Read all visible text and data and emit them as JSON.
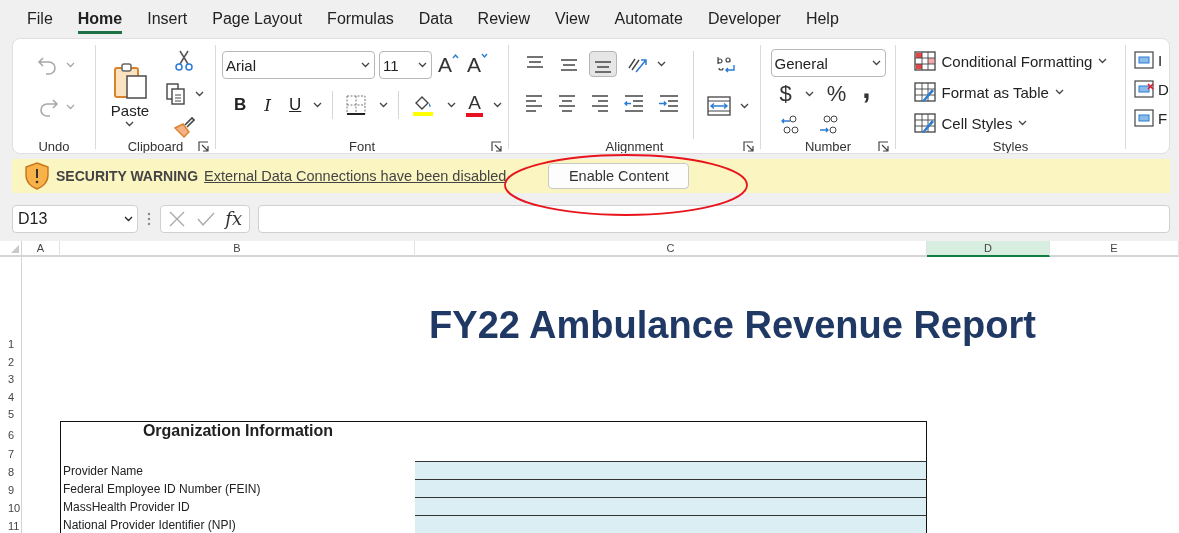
{
  "menu_tabs": [
    {
      "label": "File",
      "selected": false
    },
    {
      "label": "Home",
      "selected": true
    },
    {
      "label": "Insert",
      "selected": false
    },
    {
      "label": "Page Layout",
      "selected": false
    },
    {
      "label": "Formulas",
      "selected": false
    },
    {
      "label": "Data",
      "selected": false
    },
    {
      "label": "Review",
      "selected": false
    },
    {
      "label": "View",
      "selected": false
    },
    {
      "label": "Automate",
      "selected": false
    },
    {
      "label": "Developer",
      "selected": false
    },
    {
      "label": "Help",
      "selected": false
    }
  ],
  "ribbon": {
    "groups": [
      {
        "kind": "undo",
        "label": "Undo",
        "buttons": [
          {
            "kind": "undo",
            "disabled": true
          },
          {
            "kind": "redo",
            "disabled": true
          }
        ]
      },
      {
        "kind": "clipboard",
        "label": "Clipboard",
        "paste": "Paste"
      },
      {
        "kind": "font",
        "label": "Font",
        "font_name": "Arial",
        "font_size": "11",
        "size_buttons": [
          {
            "kind": "grow",
            "text": "A"
          },
          {
            "kind": "shrink",
            "text": "A"
          }
        ],
        "style_buttons": [
          {
            "kind": "bold",
            "text": "B"
          },
          {
            "kind": "italic",
            "text": "I"
          },
          {
            "kind": "underline",
            "text": "U"
          }
        ],
        "font_color": "A"
      },
      {
        "kind": "alignment",
        "label": "Alignment",
        "vertical": [
          {
            "selected": false
          },
          {
            "selected": false
          },
          {
            "selected": true
          }
        ]
      },
      {
        "kind": "number",
        "label": "Number",
        "format": "General",
        "symbols": [
          {
            "kind": "currency",
            "text": "$"
          },
          {
            "kind": "percent",
            "text": "%"
          },
          {
            "kind": "comma",
            "text": ","
          }
        ]
      },
      {
        "kind": "styles",
        "label": "Styles",
        "items": [
          {
            "kind": "conditional",
            "label": "Conditional Formatting"
          },
          {
            "kind": "table",
            "label": "Format as Table"
          },
          {
            "kind": "cell",
            "label": "Cell Styles"
          }
        ]
      },
      {
        "kind": "cells",
        "items": [
          {
            "kind": "insert",
            "label": "I"
          },
          {
            "kind": "delete",
            "label": "D"
          },
          {
            "kind": "format",
            "label": "F"
          }
        ]
      }
    ]
  },
  "security_bar": {
    "title": "SECURITY WARNING",
    "message": "External Data Connections have been disabled",
    "button": "Enable Content"
  },
  "formula_bar": {
    "name_box": "D13",
    "function_button": "fx"
  },
  "sheet": {
    "columns": [
      {
        "label": "A",
        "selected": false
      },
      {
        "label": "B",
        "selected": false
      },
      {
        "label": "C",
        "selected": false
      },
      {
        "label": "D",
        "selected": true
      },
      {
        "label": "E",
        "selected": false
      }
    ],
    "rows": [
      {
        "number": "1",
        "kind": "title",
        "text": "FY22 Ambulance Revenue Report"
      },
      {
        "number": "2",
        "kind": "blank"
      },
      {
        "number": "3",
        "kind": "blank"
      },
      {
        "number": "4",
        "kind": "blank"
      },
      {
        "number": "5",
        "kind": "blank"
      },
      {
        "number": "6",
        "kind": "section",
        "text": "Organization Information"
      },
      {
        "number": "7",
        "kind": "spacer"
      },
      {
        "number": "8",
        "kind": "field",
        "text": "Provider Name"
      },
      {
        "number": "9",
        "kind": "field",
        "text": "Federal Employee ID Number (FEIN)"
      },
      {
        "number": "10",
        "kind": "field",
        "text": "MassHealth Provider ID"
      },
      {
        "number": "11",
        "kind": "field",
        "text": "National Provider Identifier (NPI)"
      }
    ]
  }
}
